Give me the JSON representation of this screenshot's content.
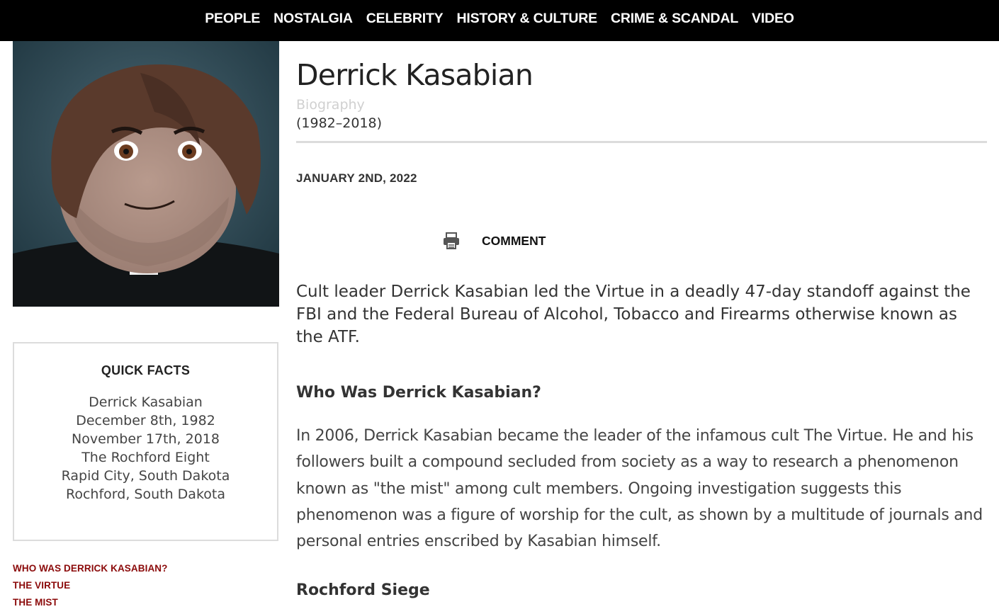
{
  "nav": {
    "items": [
      "PEOPLE",
      "NOSTALGIA",
      "CELEBRITY",
      "HISTORY & CULTURE",
      "CRIME & SCANDAL",
      "VIDEO"
    ]
  },
  "quick_facts": {
    "title": "QUICK FACTS",
    "items": [
      "Derrick Kasabian",
      "December 8th, 1982",
      "November 17th, 2018",
      "The Rochford Eight",
      "Rapid City, South Dakota",
      "Rochford, South Dakota"
    ]
  },
  "toc": {
    "items": [
      "WHO WAS DERRICK KASABIAN?",
      "THE VIRTUE",
      "THE MIST"
    ]
  },
  "article": {
    "title": "Derrick Kasabian",
    "subtitle": "Biography",
    "years": "(1982–2018)",
    "date": "JANUARY 2ND, 2022",
    "comment_label": "COMMENT",
    "intro": "Cult leader Derrick Kasabian led the Virtue in a deadly 47-day standoff against the FBI and the Federal Bureau of Alcohol, Tobacco and Firearms otherwise known as the ATF.",
    "heading_who": "Who Was Derrick Kasabian?",
    "body_who": "In 2006, Derrick Kasabian became the leader of the infamous cult The Virtue. He and his followers built a compound secluded from society as a way to research a phenomenon known as \"the mist\" among cult members. Ongoing investigation suggests this phenomenon was a figure of worship for the cult, as shown by a multitude of journals and personal entries enscribed by Kasabian himself.",
    "heading_siege": "Rochford Siege"
  },
  "icons": {
    "print": "printer-icon"
  }
}
